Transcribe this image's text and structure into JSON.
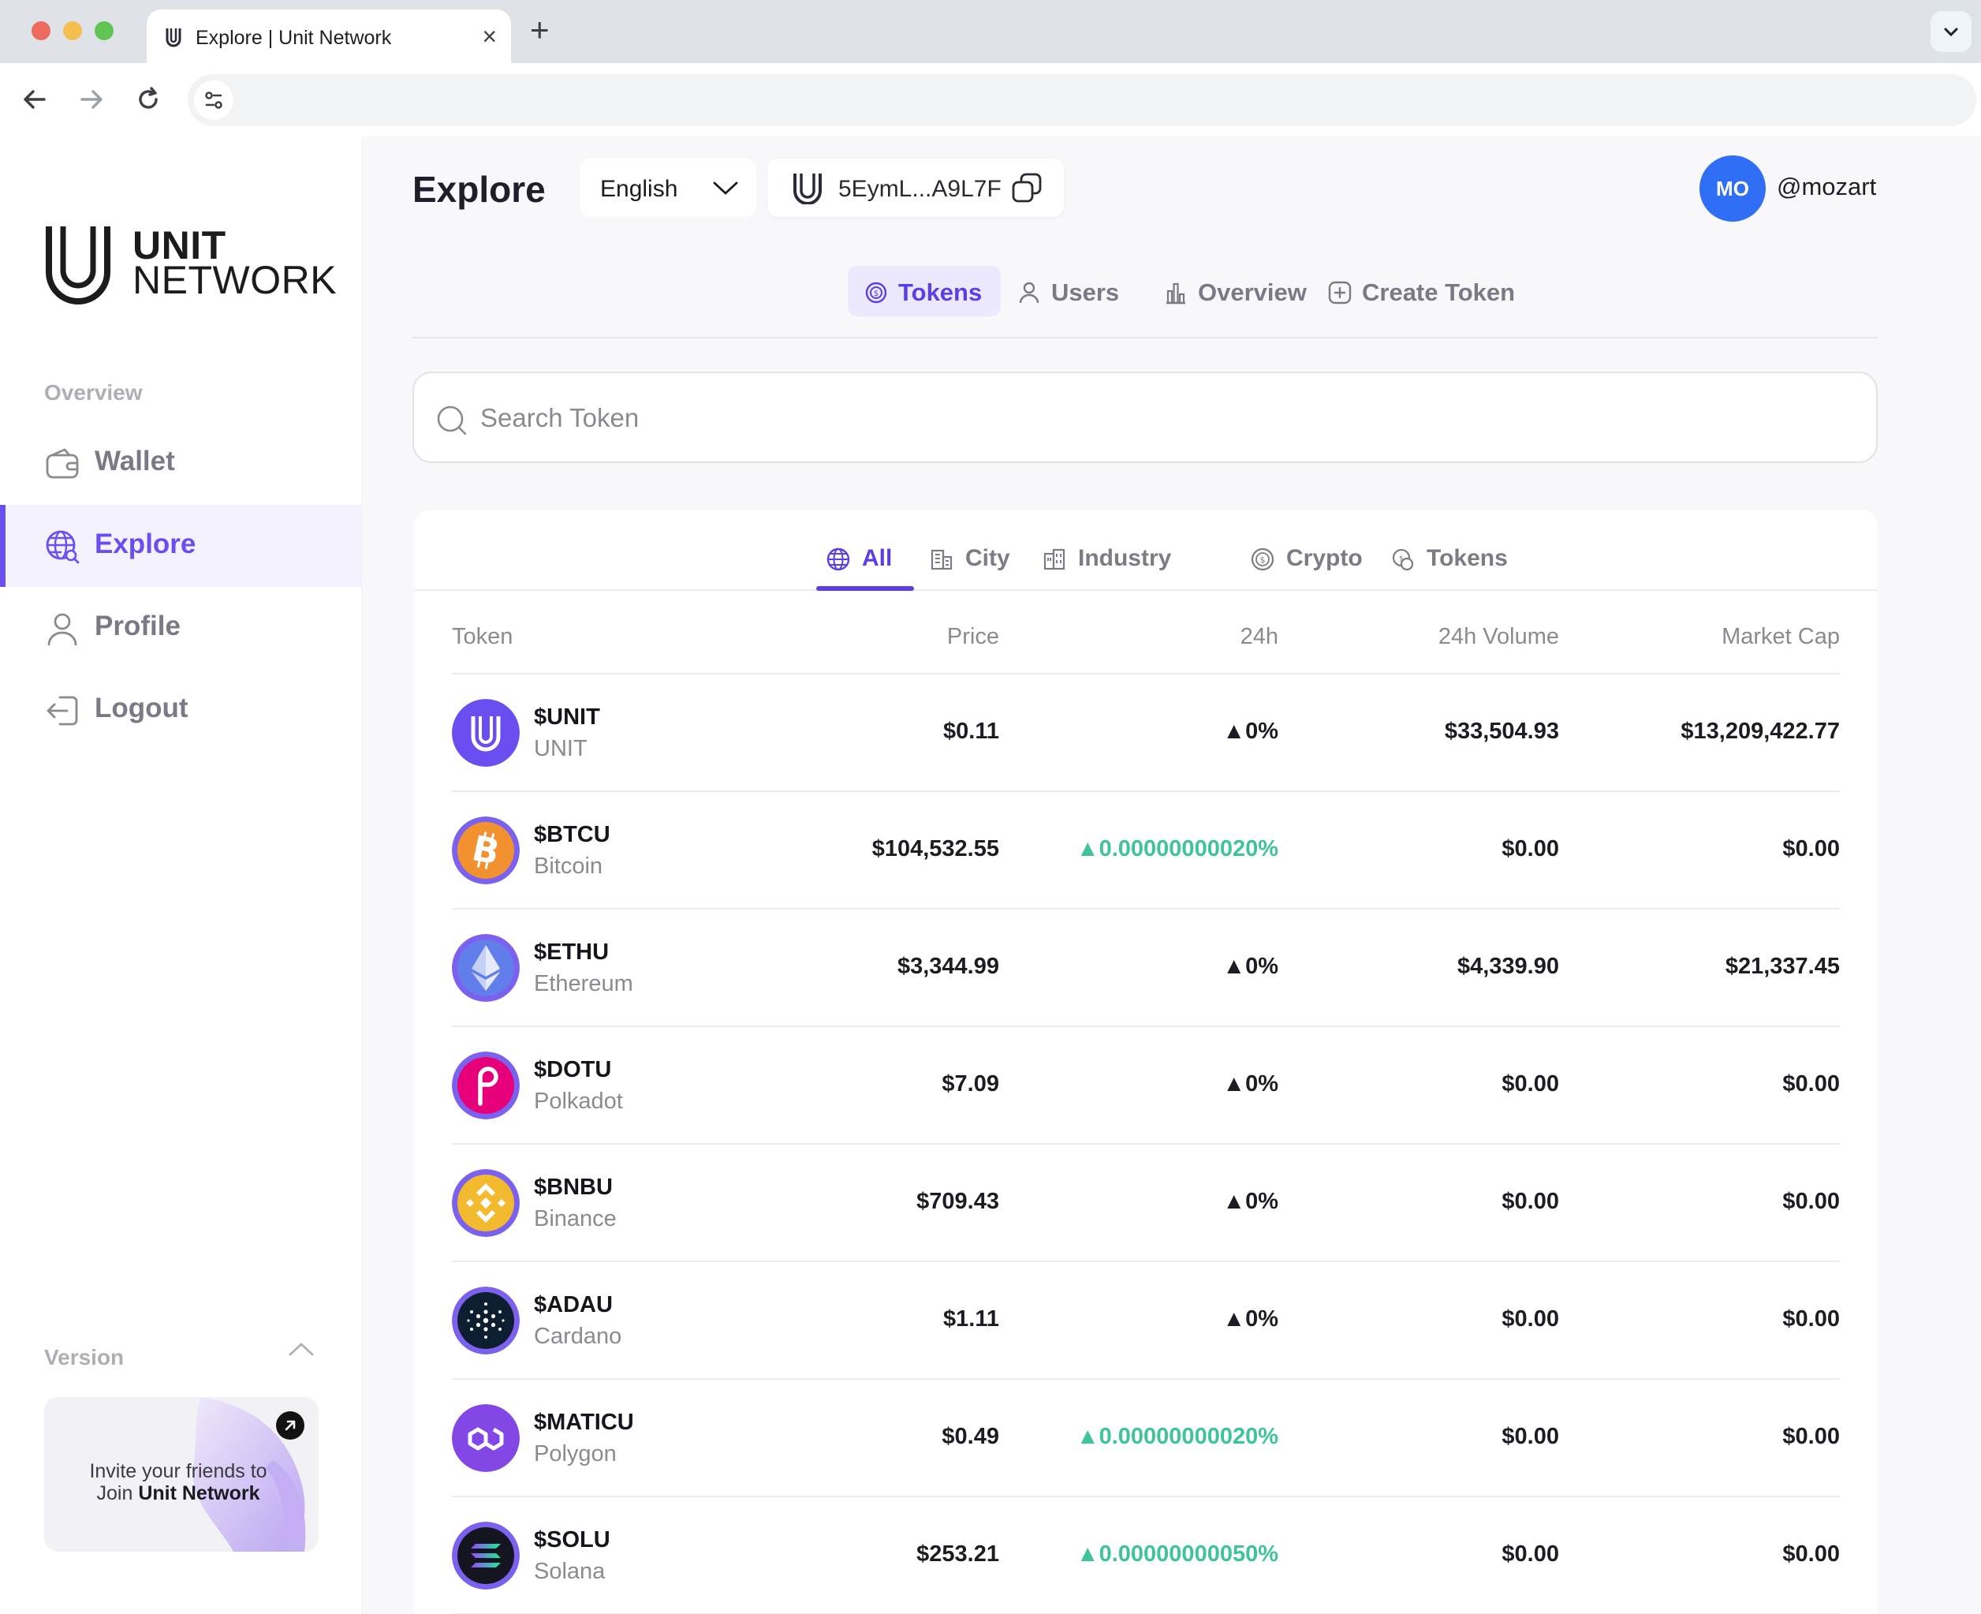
{
  "browser": {
    "tab_title": "Explore | Unit Network",
    "new_tab": "+",
    "close": "×"
  },
  "sidebar": {
    "logo_line1": "UNIT",
    "logo_line2": "NETWORK",
    "section_label": "Overview",
    "items": [
      {
        "label": "Wallet",
        "icon": "wallet-icon",
        "active": false
      },
      {
        "label": "Explore",
        "icon": "globe-search-icon",
        "active": true
      },
      {
        "label": "Profile",
        "icon": "user-icon",
        "active": false
      },
      {
        "label": "Logout",
        "icon": "logout-icon",
        "active": false
      }
    ],
    "version_label": "Version",
    "invite_line1": "Invite your friends to",
    "invite_join": "Join",
    "invite_brand": "Unit Network"
  },
  "header": {
    "title": "Explore",
    "language": "English",
    "wallet_address": "5EymL...A9L7F",
    "avatar_initials": "MO",
    "username": "@mozart"
  },
  "top_tabs": [
    {
      "label": "Tokens",
      "icon": "coin-icon",
      "active": true
    },
    {
      "label": "Users",
      "icon": "user-icon",
      "active": false
    },
    {
      "label": "Overview",
      "icon": "bar-chart-icon",
      "active": false
    },
    {
      "label": "Create Token",
      "icon": "plus-square-icon",
      "active": false
    }
  ],
  "search": {
    "placeholder": "Search Token",
    "value": ""
  },
  "category_tabs": [
    {
      "label": "All",
      "icon": "globe-icon",
      "active": true
    },
    {
      "label": "City",
      "icon": "city-icon",
      "active": false
    },
    {
      "label": "Industry",
      "icon": "industry-icon",
      "active": false
    },
    {
      "label": "Crypto",
      "icon": "crypto-coin-icon",
      "active": false
    },
    {
      "label": "Tokens",
      "icon": "tokens-icon",
      "active": false
    }
  ],
  "table": {
    "columns": [
      "Token",
      "Price",
      "24h",
      "24h Volume",
      "Market Cap"
    ],
    "rows": [
      {
        "symbol": "$UNIT",
        "name": "UNIT",
        "price": "$0.11",
        "change": "0%",
        "change_color": "dark",
        "volume": "$33,504.93",
        "market_cap": "$13,209,422.77",
        "logo": "unit-logo-icon",
        "logo_color": "#6b4ef0"
      },
      {
        "symbol": "$BTCU",
        "name": "Bitcoin",
        "price": "$104,532.55",
        "change": "0.00000000020%",
        "change_color": "green",
        "volume": "$0.00",
        "market_cap": "$0.00",
        "logo": "bitcoin-logo-icon",
        "logo_color": "#f1912f"
      },
      {
        "symbol": "$ETHU",
        "name": "Ethereum",
        "price": "$3,344.99",
        "change": "0%",
        "change_color": "dark",
        "volume": "$4,339.90",
        "market_cap": "$21,337.45",
        "logo": "ethereum-logo-icon",
        "logo_color": "#627eea"
      },
      {
        "symbol": "$DOTU",
        "name": "Polkadot",
        "price": "$7.09",
        "change": "0%",
        "change_color": "dark",
        "volume": "$0.00",
        "market_cap": "$0.00",
        "logo": "polkadot-logo-icon",
        "logo_color": "#e6007a"
      },
      {
        "symbol": "$BNBU",
        "name": "Binance",
        "price": "$709.43",
        "change": "0%",
        "change_color": "dark",
        "volume": "$0.00",
        "market_cap": "$0.00",
        "logo": "binance-logo-icon",
        "logo_color": "#f3ba2f"
      },
      {
        "symbol": "$ADAU",
        "name": "Cardano",
        "price": "$1.11",
        "change": "0%",
        "change_color": "dark",
        "volume": "$0.00",
        "market_cap": "$0.00",
        "logo": "cardano-logo-icon",
        "logo_color": "#0d1e30"
      },
      {
        "symbol": "$MATICU",
        "name": "Polygon",
        "price": "$0.49",
        "change": "0.00000000020%",
        "change_color": "green",
        "volume": "$0.00",
        "market_cap": "$0.00",
        "logo": "polygon-logo-icon",
        "logo_color": "#8247e5"
      },
      {
        "symbol": "$SOLU",
        "name": "Solana",
        "price": "$253.21",
        "change": "0.00000000050%",
        "change_color": "green",
        "volume": "$0.00",
        "market_cap": "$0.00",
        "logo": "solana-logo-icon",
        "logo_color": "#151521"
      }
    ]
  },
  "colors": {
    "accent": "#5b3fe6",
    "positive": "#3fc49a",
    "avatar": "#2f6ef5"
  }
}
